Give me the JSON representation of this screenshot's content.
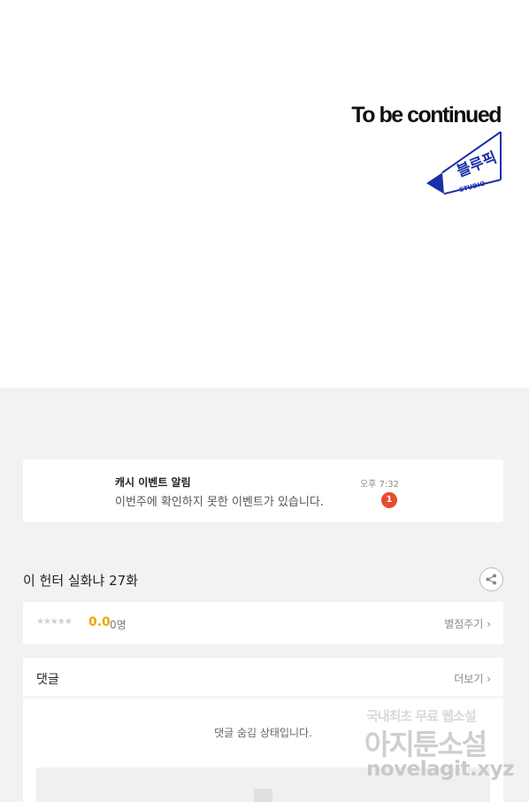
{
  "comic": {
    "end_text": "To be continued",
    "studio_logo_text": "블루픽",
    "studio_sub": "STUDIO"
  },
  "notification": {
    "title": "캐시 이벤트 알림",
    "message": "이번주에 확인하지 못한 이벤트가 있습니다.",
    "time": "오후 7:32",
    "badge_count": "1"
  },
  "episode": {
    "title": "이 헌터 실화냐 27화",
    "share_icon": "share-icon"
  },
  "rating": {
    "stars": "★★★★★",
    "score": "0.0",
    "count": "0명",
    "rate_label": "별점주기"
  },
  "comments": {
    "title": "댓글",
    "more_label": "더보기",
    "hidden_notice": "댓글 숨김 상태입니다."
  },
  "watermark": {
    "line1": "국내최초 무료 웹소설",
    "line2": "아지툰소설",
    "line3": "novelagit.xyz"
  },
  "colors": {
    "accent_rating": "#f0a500",
    "badge_red": "#e64d2e",
    "logo_blue": "#1a2fa8"
  }
}
